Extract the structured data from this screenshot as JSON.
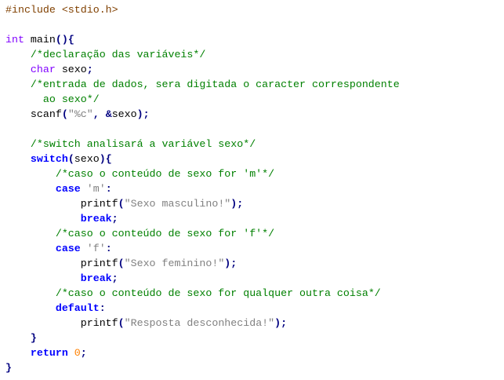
{
  "colors": {
    "background": "#ffffff",
    "default": "#000000",
    "preprocessor": "#804000",
    "type": "#8000ff",
    "keyword": "#0000ff",
    "comment": "#008000",
    "string": "#808080",
    "number": "#ff8000",
    "operator": "#000080"
  },
  "code_lines": [
    [
      {
        "t": "preprocessor",
        "v": "#include <stdio.h>"
      }
    ],
    [],
    [
      {
        "t": "type",
        "v": "int"
      },
      {
        "t": "default",
        "v": " main"
      },
      {
        "t": "operator",
        "v": "(){"
      }
    ],
    [
      {
        "t": "default",
        "v": "    "
      },
      {
        "t": "comment",
        "v": "/*declaração das variáveis*/"
      }
    ],
    [
      {
        "t": "default",
        "v": "    "
      },
      {
        "t": "type",
        "v": "char"
      },
      {
        "t": "default",
        "v": " sexo"
      },
      {
        "t": "operator",
        "v": ";"
      }
    ],
    [
      {
        "t": "default",
        "v": "    "
      },
      {
        "t": "comment",
        "v": "/*entrada de dados, sera digitada o caracter correspondente"
      }
    ],
    [
      {
        "t": "comment",
        "v": "      ao sexo*/"
      }
    ],
    [
      {
        "t": "default",
        "v": "    scanf"
      },
      {
        "t": "operator",
        "v": "("
      },
      {
        "t": "string",
        "v": "\"%c\""
      },
      {
        "t": "operator",
        "v": ","
      },
      {
        "t": "default",
        "v": " "
      },
      {
        "t": "operator",
        "v": "&"
      },
      {
        "t": "default",
        "v": "sexo"
      },
      {
        "t": "operator",
        "v": ");"
      }
    ],
    [],
    [
      {
        "t": "default",
        "v": "    "
      },
      {
        "t": "comment",
        "v": "/*switch analisará a variável sexo*/"
      }
    ],
    [
      {
        "t": "default",
        "v": "    "
      },
      {
        "t": "keyword",
        "v": "switch"
      },
      {
        "t": "operator",
        "v": "("
      },
      {
        "t": "default",
        "v": "sexo"
      },
      {
        "t": "operator",
        "v": "){"
      }
    ],
    [
      {
        "t": "default",
        "v": "        "
      },
      {
        "t": "comment",
        "v": "/*caso o conteúdo de sexo for 'm'*/"
      }
    ],
    [
      {
        "t": "default",
        "v": "        "
      },
      {
        "t": "keyword",
        "v": "case"
      },
      {
        "t": "default",
        "v": " "
      },
      {
        "t": "string",
        "v": "'m'"
      },
      {
        "t": "operator",
        "v": ":"
      }
    ],
    [
      {
        "t": "default",
        "v": "            printf"
      },
      {
        "t": "operator",
        "v": "("
      },
      {
        "t": "string",
        "v": "\"Sexo masculino!\""
      },
      {
        "t": "operator",
        "v": ");"
      }
    ],
    [
      {
        "t": "default",
        "v": "            "
      },
      {
        "t": "keyword",
        "v": "break"
      },
      {
        "t": "operator",
        "v": ";"
      }
    ],
    [
      {
        "t": "default",
        "v": "        "
      },
      {
        "t": "comment",
        "v": "/*caso o conteúdo de sexo for 'f'*/"
      }
    ],
    [
      {
        "t": "default",
        "v": "        "
      },
      {
        "t": "keyword",
        "v": "case"
      },
      {
        "t": "default",
        "v": " "
      },
      {
        "t": "string",
        "v": "'f'"
      },
      {
        "t": "operator",
        "v": ":"
      }
    ],
    [
      {
        "t": "default",
        "v": "            printf"
      },
      {
        "t": "operator",
        "v": "("
      },
      {
        "t": "string",
        "v": "\"Sexo feminino!\""
      },
      {
        "t": "operator",
        "v": ");"
      }
    ],
    [
      {
        "t": "default",
        "v": "            "
      },
      {
        "t": "keyword",
        "v": "break"
      },
      {
        "t": "operator",
        "v": ";"
      }
    ],
    [
      {
        "t": "default",
        "v": "        "
      },
      {
        "t": "comment",
        "v": "/*caso o conteúdo de sexo for qualquer outra coisa*/"
      }
    ],
    [
      {
        "t": "default",
        "v": "        "
      },
      {
        "t": "keyword",
        "v": "default"
      },
      {
        "t": "operator",
        "v": ":"
      }
    ],
    [
      {
        "t": "default",
        "v": "            printf"
      },
      {
        "t": "operator",
        "v": "("
      },
      {
        "t": "string",
        "v": "\"Resposta desconhecida!\""
      },
      {
        "t": "operator",
        "v": ");"
      }
    ],
    [
      {
        "t": "default",
        "v": "    "
      },
      {
        "t": "operator",
        "v": "}"
      }
    ],
    [
      {
        "t": "default",
        "v": "    "
      },
      {
        "t": "keyword",
        "v": "return"
      },
      {
        "t": "default",
        "v": " "
      },
      {
        "t": "number",
        "v": "0"
      },
      {
        "t": "operator",
        "v": ";"
      }
    ],
    [
      {
        "t": "operator",
        "v": "}"
      }
    ]
  ]
}
